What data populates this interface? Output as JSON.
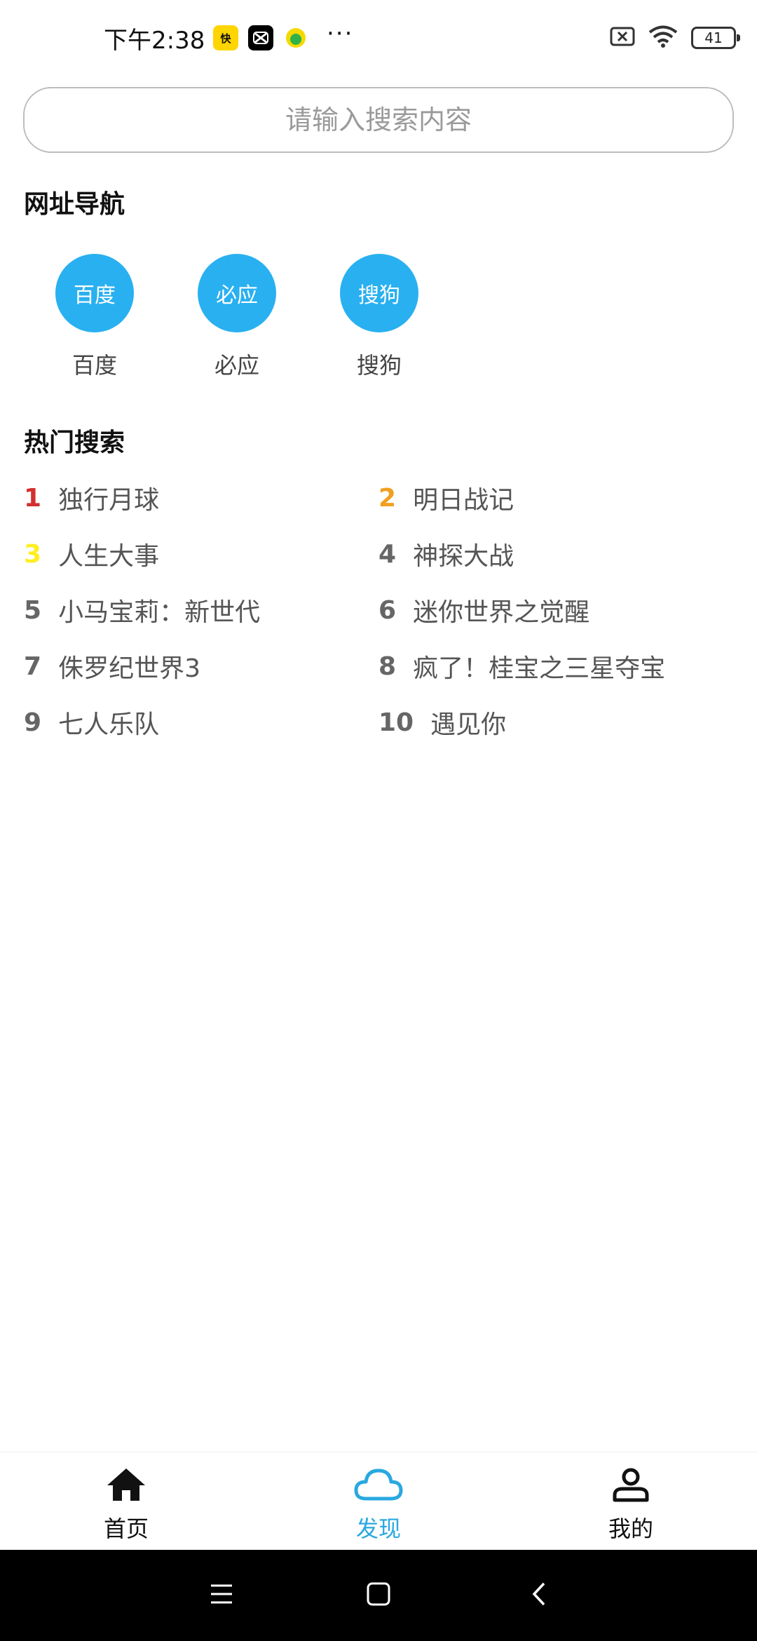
{
  "status_bar": {
    "time": "下午2:38",
    "app_icons": [
      "快看",
      "剪映",
      "QQ音乐"
    ],
    "more": "···",
    "battery": "41"
  },
  "search": {
    "placeholder": "请输入搜索内容"
  },
  "nav_section": {
    "title": "网址导航",
    "items": [
      {
        "icon_text": "百度",
        "label": "百度"
      },
      {
        "icon_text": "必应",
        "label": "必应"
      },
      {
        "icon_text": "搜狗",
        "label": "搜狗"
      }
    ]
  },
  "hot_section": {
    "title": "热门搜索",
    "items": [
      {
        "rank": "1",
        "title": "独行月球"
      },
      {
        "rank": "2",
        "title": "明日战记"
      },
      {
        "rank": "3",
        "title": "人生大事"
      },
      {
        "rank": "4",
        "title": "神探大战"
      },
      {
        "rank": "5",
        "title": "小马宝莉：新世代"
      },
      {
        "rank": "6",
        "title": "迷你世界之觉醒"
      },
      {
        "rank": "7",
        "title": "侏罗纪世界3"
      },
      {
        "rank": "8",
        "title": "疯了！桂宝之三星夺宝"
      },
      {
        "rank": "9",
        "title": "七人乐队"
      },
      {
        "rank": "10",
        "title": "遇见你"
      }
    ],
    "rank_colors": {
      "1": "#d32f2f",
      "2": "#f0a020",
      "3": "#ffee22",
      "other": "#666666"
    }
  },
  "tabbar": {
    "items": [
      {
        "label": "首页",
        "icon": "home-icon"
      },
      {
        "label": "发现",
        "icon": "cloud-icon"
      },
      {
        "label": "我的",
        "icon": "person-icon"
      }
    ],
    "active_color": "#29a8e0"
  },
  "colors": {
    "accent": "#29b0f0"
  }
}
